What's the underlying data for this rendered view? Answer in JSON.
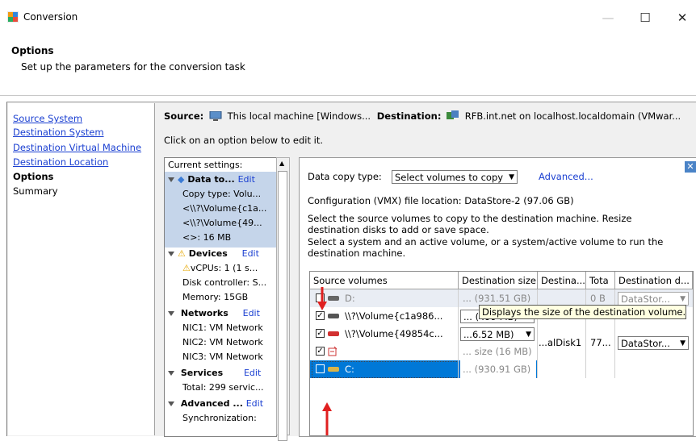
{
  "window": {
    "title": "Conversion",
    "minimize": "—",
    "maximize": "☐",
    "close": "✕"
  },
  "header": {
    "title": "Options",
    "subtitle": "Set up the parameters for the conversion task"
  },
  "nav": {
    "items": [
      {
        "label": "Source System"
      },
      {
        "label": "Destination System"
      },
      {
        "label": "Destination Virtual Machine"
      },
      {
        "label": "Destination Location"
      },
      {
        "label": "Options"
      },
      {
        "label": "Summary"
      }
    ]
  },
  "source_line": {
    "source_label": "Source:",
    "source_value": "This local machine [Windows...",
    "dest_label": "Destination:",
    "dest_value": "RFB.int.net on localhost.localdomain (VMwar..."
  },
  "instruction": "Click on an option below to edit it.",
  "settings": {
    "header": "Current settings:",
    "data_title": "Data to...",
    "edit": "Edit",
    "data_lines": [
      "Copy type: Volu...",
      "<\\\\?\\Volume{c1a...",
      "<\\\\?\\Volume{49...",
      "<>: 16 MB"
    ],
    "devices_title": "Devices",
    "devices_lines": [
      "vCPUs: 1 (1 s...",
      "Disk controller: S...",
      "Memory: 15GB"
    ],
    "networks_title": "Networks",
    "networks_lines": [
      "NIC1: VM Network",
      "NIC2: VM Network",
      "NIC3: VM Network"
    ],
    "services_title": "Services",
    "services_lines": [
      "Total: 299 servic..."
    ],
    "advanced_title": "Advanced ...",
    "advanced_lines": [
      "Synchronization:"
    ]
  },
  "panel": {
    "copy_type_label": "Data copy type:",
    "copy_type_value": "Select volumes to copy",
    "advanced_link": "Advanced...",
    "vmx_line": "Configuration (VMX) file location: DataStore-2 (97.06 GB)",
    "instr1": "Select the source volumes to copy to the destination machine. Resize",
    "instr2": "destination disks to add or save space.",
    "instr3": "Select a system and an active volume, or a system/active volume to run the",
    "instr4": "destination machine."
  },
  "grid": {
    "headers": [
      "Source volumes",
      "Destination size",
      "Destina...",
      "Tota",
      "Destination d..."
    ],
    "rows": [
      {
        "name": "D:",
        "size": "... (931.51 GB)",
        "destina": "",
        "total": "0 B",
        "datastore": "DataStor...",
        "checked": ""
      },
      {
        "name": "\\\\?\\Volume{c1a986...",
        "size": "... (499 MB)",
        "destina": "",
        "total": "",
        "datastore": "",
        "checked": "✓"
      },
      {
        "name": "\\\\?\\Volume{49854c...",
        "size": "...6.52 MB)",
        "destina": "...alDisk1",
        "total": "77...",
        "datastore": "DataStor...",
        "checked": "✓"
      },
      {
        "name": "",
        "size": "... size (16 MB)",
        "destina": "",
        "total": "",
        "datastore": "",
        "checked": "✓"
      },
      {
        "name": "C:",
        "size": "... (930.91 GB)",
        "destina": "",
        "total": "",
        "datastore": "",
        "checked": ""
      }
    ],
    "tooltip": "Displays the size of the destination volume."
  },
  "colors": {
    "link": "#1a3fd1",
    "selection": "#0078d7",
    "highlight": "#c5d5ea",
    "arrow": "#e02020"
  }
}
